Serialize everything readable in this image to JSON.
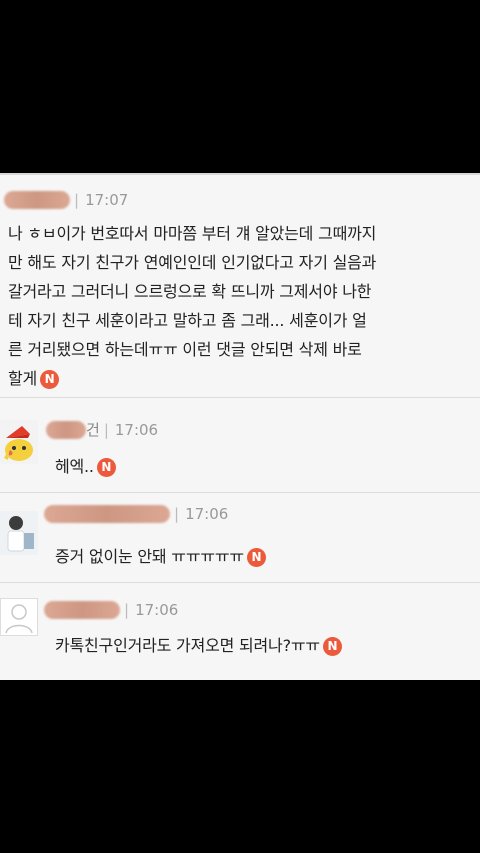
{
  "badge_label": "N",
  "comments": [
    {
      "time": "17:07",
      "text_lines": [
        "나 ㅎㅂ이가 번호따서 마마쯤 부터 걔 알았는데 그때까지",
        "만 해도 자기 친구가 연예인인데 인기없다고 자기 실음과",
        "갈거라고 그러더니 으르렁으로 확 뜨니까 그제서야 나한",
        "테 자기 친구 세훈이라고 말하고 좀 그래... 세훈이가 얼",
        "른 거리됐으면 하는데ㅠㅠ 이런 댓글 안되면 삭제 바로",
        "할게"
      ]
    },
    {
      "name_tail": "건",
      "time": "17:06",
      "text": "헤엑.."
    },
    {
      "time": "17:06",
      "text": "증거 없이눈 안돼 ㅠㅠㅠㅠㅠ"
    },
    {
      "time": "17:06",
      "text": "카톡친구인거라도 가져오면 되려나?ㅠㅠ"
    }
  ],
  "colors": {
    "badge": "#ec5a3c",
    "background": "#f6f6f6"
  }
}
